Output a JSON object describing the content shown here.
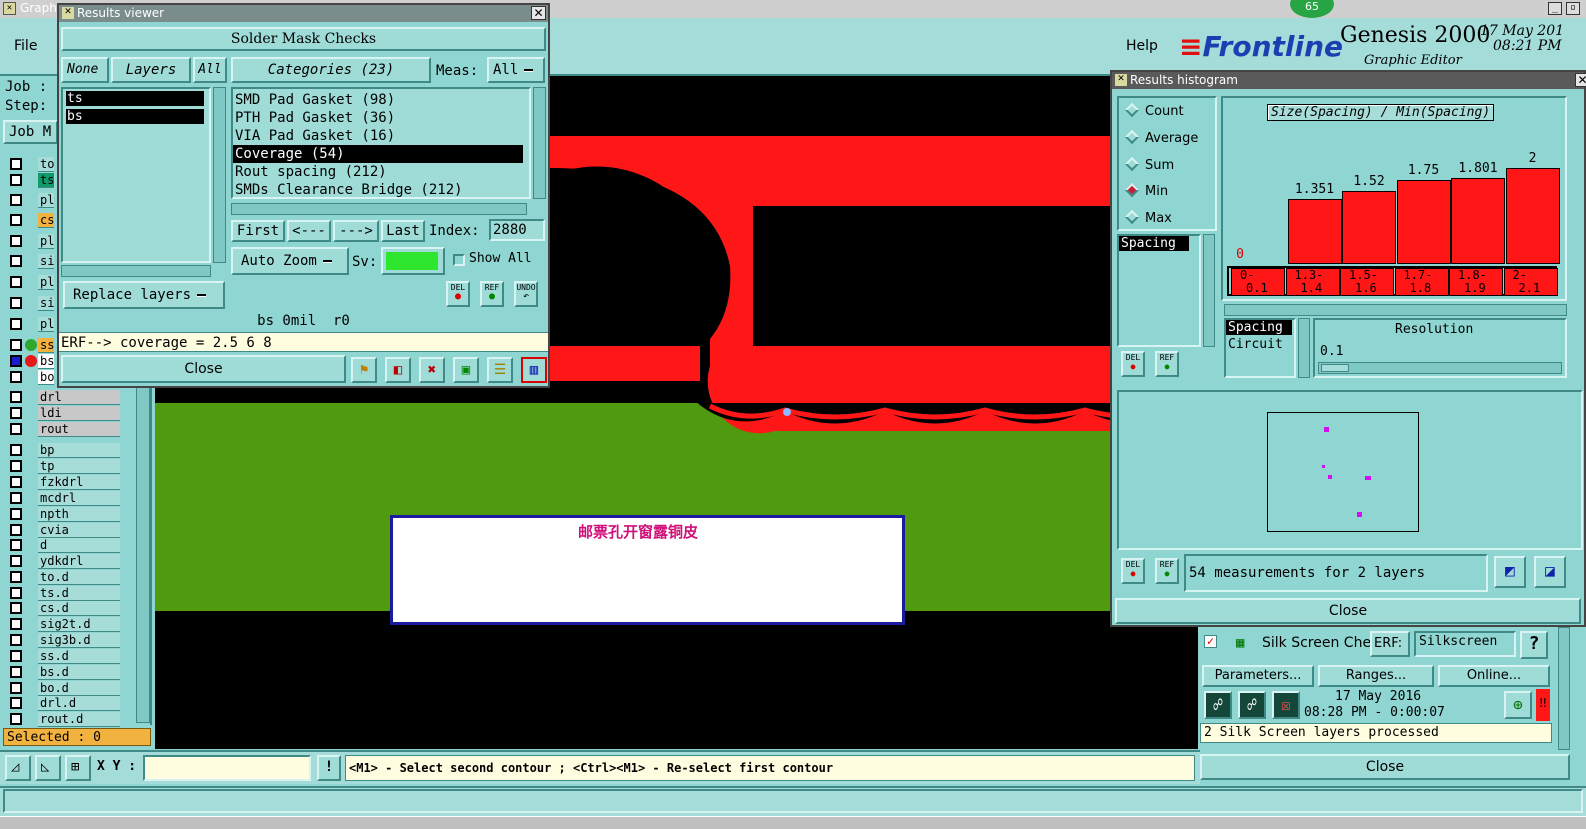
{
  "main_window": {
    "title": "Graph",
    "menu_file": "File",
    "menu_help": "Help",
    "job_label": "Job :",
    "step_label": "Step:",
    "job_btn": "Job M",
    "brand": "Frontline",
    "product": "Genesis 2000",
    "subtitle": "Graphic Editor",
    "date": "17 May 201",
    "time": "08:21 PM",
    "badge": "65"
  },
  "layers": [
    {
      "name": "to"
    },
    {
      "name": "ts"
    },
    {
      "name": "pl"
    },
    {
      "name": "cs"
    },
    {
      "name": "pl"
    },
    {
      "name": "si"
    },
    {
      "name": "pl"
    },
    {
      "name": "si"
    },
    {
      "name": "pl"
    },
    {
      "name": "ss"
    },
    {
      "name": "bs"
    },
    {
      "name": "bo"
    },
    {
      "name": "drl"
    },
    {
      "name": "ldi"
    },
    {
      "name": "rout"
    },
    {
      "name": "bp"
    },
    {
      "name": "tp"
    },
    {
      "name": "fzkdrl"
    },
    {
      "name": "mcdrl"
    },
    {
      "name": "npth"
    },
    {
      "name": "cvia"
    },
    {
      "name": "d"
    },
    {
      "name": "ydkdrl"
    },
    {
      "name": "to.d"
    },
    {
      "name": "ts.d"
    },
    {
      "name": "cs.d"
    },
    {
      "name": "sig2t.d"
    },
    {
      "name": "sig3b.d"
    },
    {
      "name": "ss.d"
    },
    {
      "name": "bs.d"
    },
    {
      "name": "bo.d"
    },
    {
      "name": "drl.d"
    },
    {
      "name": "rout.d"
    }
  ],
  "status": {
    "selected": "Selected : 0",
    "xy_label": "X Y :",
    "xy_value": "",
    "hint": "<M1> - Select second contour ; <Ctrl><M1> - Re-select first contour"
  },
  "canvas_note": "邮票孔开窗露铜皮",
  "results_viewer": {
    "title": "Results viewer",
    "header": "Solder Mask Checks",
    "none": "None",
    "layers": "Layers",
    "all": "All",
    "categories": "Categories (23)",
    "meas_label": "Meas:",
    "meas_value": "All",
    "layer_items": [
      "ts",
      "bs"
    ],
    "category_items": [
      "SMD Pad Gasket (98)",
      "PTH Pad Gasket (36)",
      "VIA Pad Gasket (16)",
      "Coverage (54)",
      "Rout spacing (212)",
      "SMDs Clearance Bridge (212)"
    ],
    "first": "First",
    "prev": "<---",
    "next": "--->",
    "last": "Last",
    "index_label": "Index:",
    "index_value": "2880",
    "auto_zoom": "Auto Zoom",
    "sv_label": "Sv:",
    "show_all": "Show All",
    "replace_layers": "Replace layers",
    "info": "bs 0mil  r0",
    "erf": "ERF--> coverage = 2.5 6 8",
    "close": "Close",
    "del": "DEL",
    "ref": "REF",
    "undo": "UNDO"
  },
  "histogram": {
    "title": "Results histogram",
    "options": [
      "Count",
      "Average",
      "Sum",
      "Min",
      "Max"
    ],
    "selected_option": "Min",
    "formula": "Size(Spacing) / Min(Spacing)",
    "bar_labels": [
      "0",
      "1.351",
      "1.52",
      "1.75",
      "1.801",
      "2"
    ],
    "bar_values": [
      0,
      1.351,
      1.52,
      1.75,
      1.801,
      2
    ],
    "ranges": [
      [
        "0-",
        "0.1"
      ],
      [
        "1.3-",
        "1.4"
      ],
      [
        "1.5-",
        "1.6"
      ],
      [
        "1.7-",
        "1.8"
      ],
      [
        "1.8-",
        "1.9"
      ],
      [
        "2-",
        "2.1"
      ]
    ],
    "list_item": "Spacing",
    "type_items": [
      "Spacing",
      "Circuit"
    ],
    "resolution_label": "Resolution",
    "resolution_value": "0.1",
    "measurements": "54 measurements for 2 layers",
    "close": "Close",
    "del": "DEL",
    "ref": "REF"
  },
  "silk": {
    "title": "Silk Screen Che",
    "erf_label": "ERF:",
    "erf_value": "Silkscreen",
    "help": "?",
    "parameters": "Parameters...",
    "ranges": "Ranges...",
    "online": "Online...",
    "date": "17 May 2016",
    "time": "08:28 PM - 0:00:07",
    "status": "2 Silk Screen layers processed",
    "close": "Close"
  },
  "colors": {
    "red": "#ff1616",
    "green": "#4f9a0e",
    "panel": "#9fdcd8",
    "bg": "#8fd6d2"
  }
}
